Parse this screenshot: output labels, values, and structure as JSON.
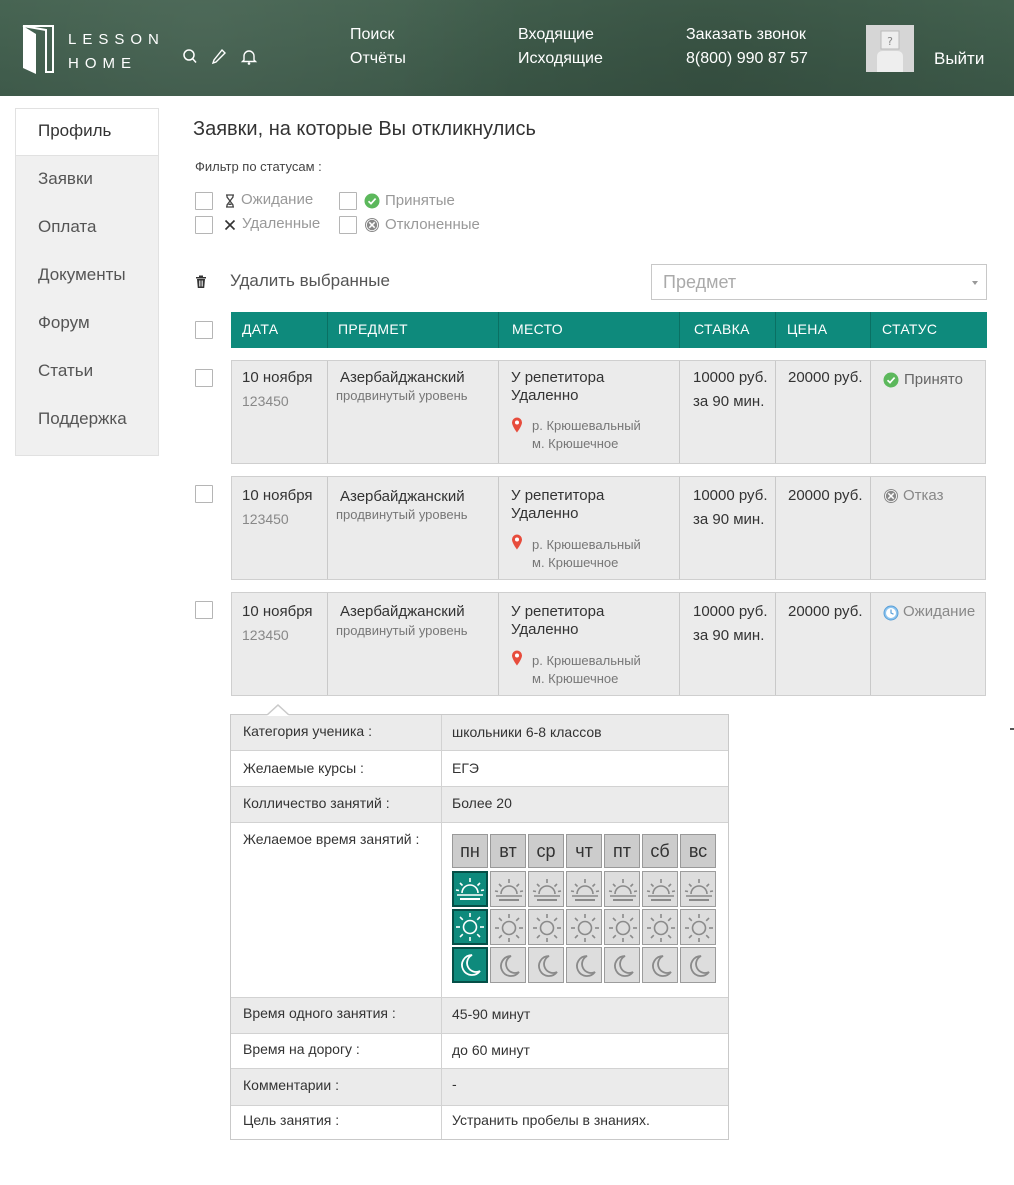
{
  "header": {
    "logo_line1": "LESSON",
    "logo_line2": "HOME",
    "icons": [
      "search-icon",
      "pencil-icon",
      "bell-icon"
    ],
    "nav": [
      {
        "label": "Поиск"
      },
      {
        "label": "Отчёты"
      },
      {
        "label": "Входящие"
      },
      {
        "label": "Исходящие"
      },
      {
        "label": "Заказать звонок"
      },
      {
        "label": "8(800) 990 87 57"
      }
    ],
    "logout": "Выйти"
  },
  "sidebar": {
    "items": [
      {
        "label": "Профиль",
        "active": true
      },
      {
        "label": "Заявки"
      },
      {
        "label": "Оплата"
      },
      {
        "label": "Документы"
      },
      {
        "label": "Форум"
      },
      {
        "label": "Статьи"
      },
      {
        "label": "Поддержка"
      }
    ]
  },
  "main": {
    "title": "Заявки, на которые Вы откликнулись",
    "filter_label": "Фильтр по статусам :",
    "filters": [
      {
        "label": "Ожидание",
        "icon": "hourglass-icon"
      },
      {
        "label": "Принятые",
        "icon": "check-circle-icon"
      },
      {
        "label": "Удаленные",
        "icon": "cross-icon"
      },
      {
        "label": "Отклоненные",
        "icon": "cancel-circle-icon"
      }
    ],
    "delete_selected": "Удалить выбранные",
    "subject_select": {
      "placeholder": "Предмет"
    }
  },
  "table": {
    "columns": [
      "ДАТА",
      "ПРЕДМЕТ",
      "МЕСТО",
      "СТАВКА",
      "ЦЕНА",
      "СТАТУС"
    ],
    "rows": [
      {
        "date": "10 ноября",
        "id": "123450",
        "subject": "Азербайджанский",
        "level": "продвинутый уровень",
        "place1": "У репетитора",
        "place2": "Удаленно",
        "region": "р. Крюшевальный",
        "metro": "м. Крюшечное",
        "rate1": "10000 руб.",
        "rate2": "за 90 мин.",
        "price": "20000 руб.",
        "status": "Принято",
        "status_icon": "check-circle-icon",
        "status_color": "#4caf50"
      },
      {
        "date": "10 ноября",
        "id": "123450",
        "subject": "Азербайджанский",
        "level": "продвинутый уровень",
        "place1": "У репетитора",
        "place2": "Удаленно",
        "region": "р. Крюшевальный",
        "metro": "м. Крюшечное",
        "rate1": "10000 руб.",
        "rate2": "за 90 мин.",
        "price": "20000 руб.",
        "status": "Отказ",
        "status_icon": "cancel-circle-icon",
        "status_color": "#777777"
      },
      {
        "date": "10 ноября",
        "id": "123450",
        "subject": "Азербайджанский",
        "level": "продвинутый уровень",
        "place1": "У репетитора",
        "place2": "Удаленно",
        "region": "р. Крюшевальный",
        "metro": "м. Крюшечное",
        "rate1": "10000 руб.",
        "rate2": "за 90 мин.",
        "price": "20000 руб.",
        "status": "Ожидание",
        "status_icon": "clock-icon",
        "status_color": "#5aa0d8"
      }
    ]
  },
  "details": {
    "student_category_label": "Категория ученика :",
    "student_category": "школьники 6-8 классов",
    "courses_label": "Желаемые курсы  :",
    "courses": "ЕГЭ",
    "lessons_count_label": "Колличество занятий  :",
    "lessons_count": "Более 20",
    "schedule_label": "Желаемое время занятий  :",
    "days": [
      "пн",
      "вт",
      "ср",
      "чт",
      "пт",
      "сб",
      "вс"
    ],
    "schedule_selected": {
      "morning": [
        "пн"
      ],
      "day": [
        "пн"
      ],
      "evening": [
        "пн"
      ]
    },
    "lesson_duration_label": "Время одного занятия  :",
    "lesson_duration": "45-90 минут",
    "travel_time_label": "Время на дорогу  :",
    "travel_time": "до 60 минут",
    "comments_label": "Комментарии :",
    "comments": "-",
    "goal_label": "Цель занятия :",
    "goal": "Устранить пробелы в знаниях."
  },
  "colors": {
    "accent": "#0e8a7c",
    "header_bg": "#3e5b4a"
  }
}
